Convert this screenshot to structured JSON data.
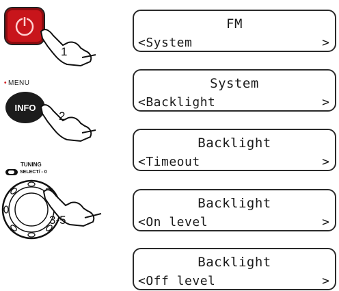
{
  "steps": [
    {
      "button": "power-icon",
      "number": "1"
    },
    {
      "button_label": "INFO",
      "above_label": "MENU",
      "number": "2"
    },
    {
      "above_label": "TUNING",
      "below_label": "SELECT",
      "below_suffix": "/ - 0",
      "number": "3-5"
    }
  ],
  "screens": [
    {
      "line1": "FM",
      "line2": "<System",
      "arrow": ">"
    },
    {
      "line1": "System",
      "line2": "<Backlight",
      "arrow": ">"
    },
    {
      "line1": "Backlight",
      "line2": "<Timeout",
      "arrow": ">"
    },
    {
      "line1": "Backlight",
      "line2": "<On level",
      "arrow": ">"
    },
    {
      "line1": "Backlight",
      "line2": "<Off level",
      "arrow": ">"
    }
  ],
  "colors": {
    "power_red": "#c8151b",
    "menu_dot": "#d21b1f",
    "info_black": "#1c1c1c"
  }
}
